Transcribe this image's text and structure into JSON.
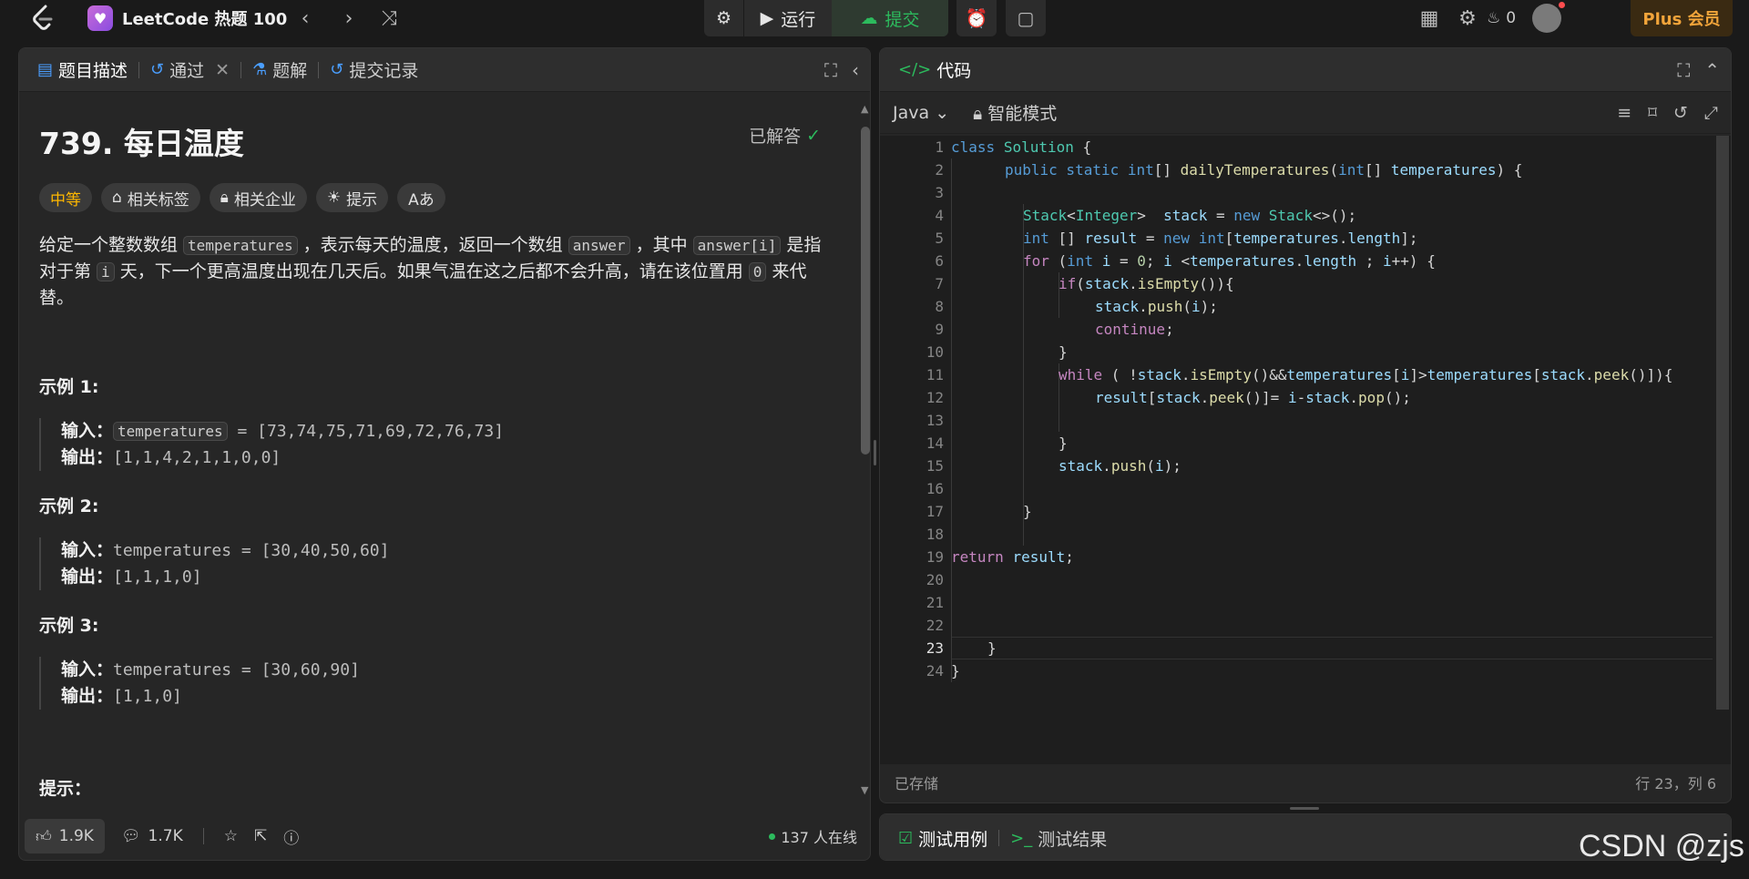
{
  "topbar": {
    "list_title": "LeetCode 热题 100",
    "run_label": "运行",
    "submit_label": "提交",
    "streak_count": "0",
    "plus_label": "Plus 会员"
  },
  "left": {
    "tabs": [
      "题目描述",
      "通过",
      "题解",
      "提交记录"
    ],
    "problem_title": "739. 每日温度",
    "solved_label": "已解答",
    "tags": [
      "中等",
      "相关标签",
      "相关企业",
      "提示",
      "Aあ"
    ],
    "desc": {
      "p1": "给定一个整数数组 ",
      "c1": "temperatures",
      "p2": " ，表示每天的温度，返回一个数组 ",
      "c2": "answer",
      "p3": " ，其中 ",
      "c3": "answer[i]",
      "p4": " 是指对于第 ",
      "c4": "i",
      "p5": " 天，下一个更高温度出现在几天后。如果气温在这之后都不会升高，请在该位置用 ",
      "c5": "0",
      "p6": " 来代替。"
    },
    "examples": [
      {
        "heading": "示例 1:",
        "input_label": "输入：",
        "input_var": "temperatures",
        "input_rest": " = [73,74,75,71,69,72,76,73]",
        "output_label": "输出：",
        "output": "[1,1,4,2,1,1,0,0]"
      },
      {
        "heading": "示例 2:",
        "input_label": "输入：",
        "input_var": "temperatures",
        "input_rest": " = [30,40,50,60]",
        "output_label": "输出：",
        "output": "[1,1,1,0]"
      },
      {
        "heading": "示例 3:",
        "input_label": "输入：",
        "input_var": "temperatures",
        "input_rest": " = [30,60,90]",
        "output_label": "输出：",
        "output": "[1,1,0]"
      }
    ],
    "hints_heading": "提示：",
    "footer": {
      "likes": "1.9K",
      "comments": "1.7K",
      "online": "137 人在线"
    }
  },
  "right": {
    "title": "代码",
    "language": "Java",
    "mode": "智能模式",
    "line_numbers": [
      "1",
      "2",
      "3",
      "4",
      "5",
      "6",
      "7",
      "8",
      "9",
      "10",
      "11",
      "12",
      "13",
      "14",
      "15",
      "16",
      "17",
      "18",
      "19",
      "20",
      "21",
      "22",
      "23",
      "24"
    ],
    "saved_label": "已存储",
    "cursor_pos": "行 23，列 6",
    "test_tab": "测试用例",
    "result_tab": "测试结果"
  },
  "watermark": "CSDN @zjs"
}
